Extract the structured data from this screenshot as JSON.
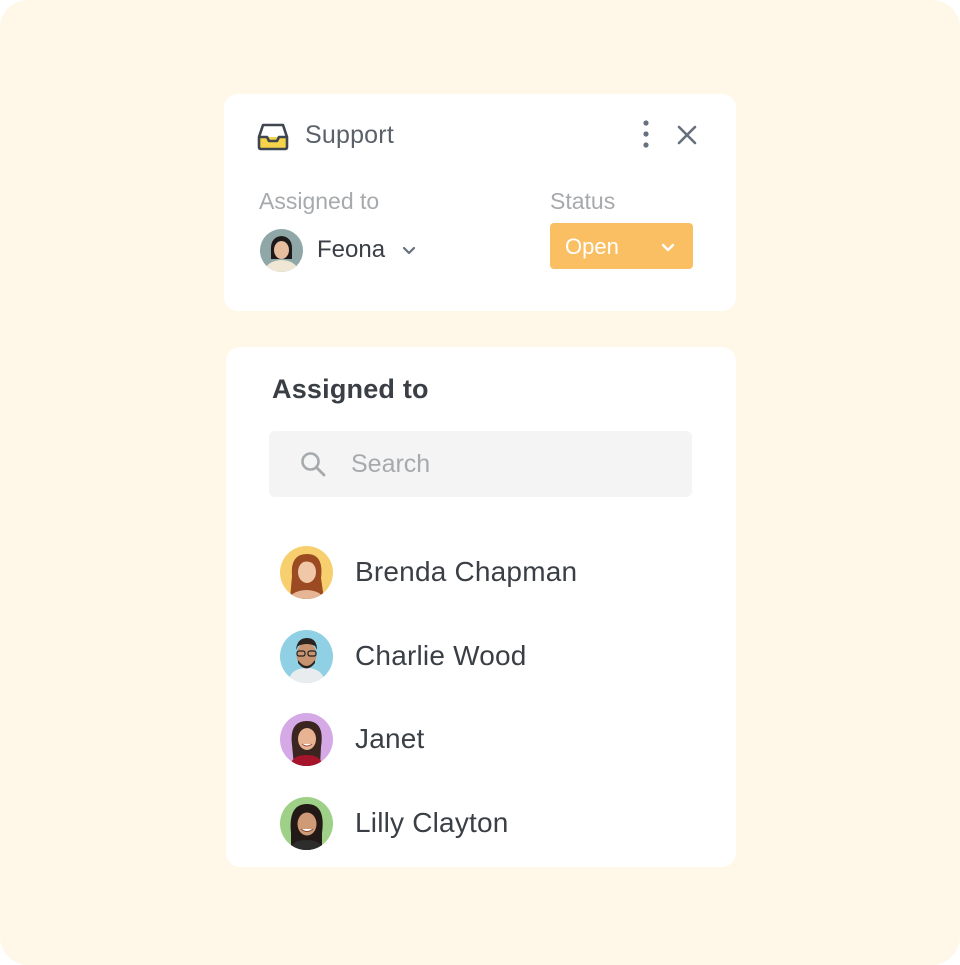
{
  "header": {
    "title": "Support",
    "icon": "inbox-icon",
    "menu_icon": "more-vertical-icon",
    "close_icon": "close-icon"
  },
  "ticket": {
    "assigned_label": "Assigned to",
    "assignee": {
      "name": "Feona",
      "avatar": "avatar-feona"
    },
    "status_label": "Status",
    "status_value": "Open"
  },
  "assign_panel": {
    "heading": "Assigned to",
    "search": {
      "placeholder": "Search",
      "value": ""
    },
    "people": [
      {
        "name": "Brenda Chapman",
        "avatar_bg": "#f7cf6e"
      },
      {
        "name": "Charlie Wood",
        "avatar_bg": "#8fd0e4"
      },
      {
        "name": "Janet",
        "avatar_bg": "#d5a8e6"
      },
      {
        "name": "Lilly Clayton",
        "avatar_bg": "#9fd087"
      }
    ]
  },
  "colors": {
    "page_bg": "#fff7e8",
    "status_open": "#fbbf63",
    "text_dark": "#3a3f45",
    "text_muted": "#a7aaad"
  }
}
